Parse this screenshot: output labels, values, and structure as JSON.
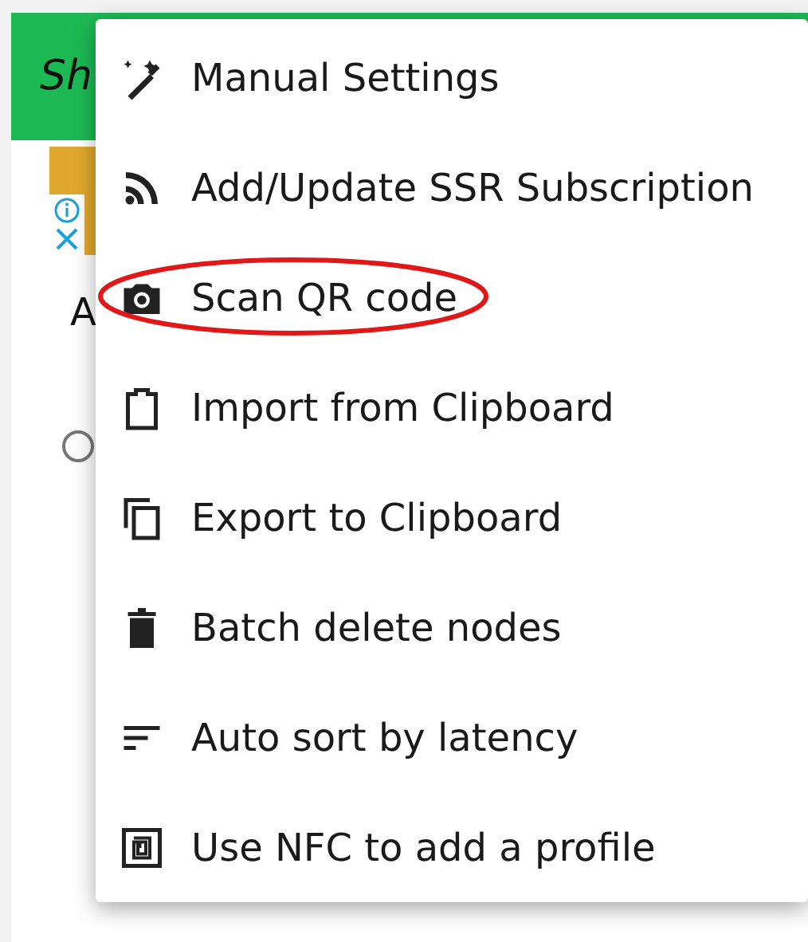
{
  "app_bar": {
    "title": "Sh"
  },
  "content": {
    "label": "A",
    "radio": {
      "selected": false
    }
  },
  "menu": {
    "items": [
      {
        "kind": "wand",
        "label": "Manual Settings",
        "highlighted": false
      },
      {
        "kind": "rss",
        "label": "Add/Update SSR Subscription",
        "highlighted": false
      },
      {
        "kind": "camera",
        "label": "Scan QR code",
        "highlighted": true
      },
      {
        "kind": "clipboard",
        "label": "Import from Clipboard",
        "highlighted": false
      },
      {
        "kind": "copy",
        "label": "Export to Clipboard",
        "highlighted": false
      },
      {
        "kind": "trash",
        "label": "Batch delete nodes",
        "highlighted": false
      },
      {
        "kind": "sort",
        "label": "Auto sort by latency",
        "highlighted": false
      },
      {
        "kind": "nfc",
        "label": "Use NFC to add a profile",
        "highlighted": false
      }
    ]
  }
}
